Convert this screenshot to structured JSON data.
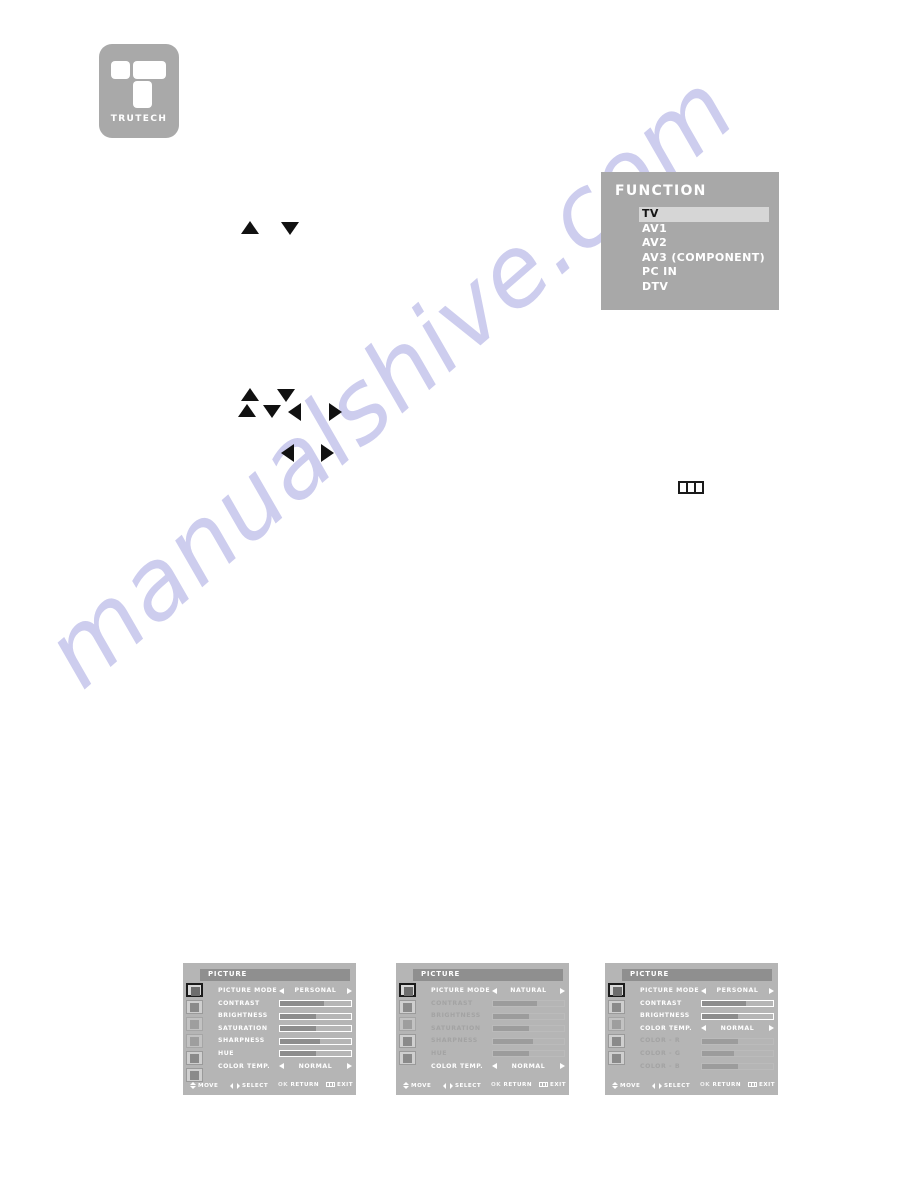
{
  "brand": {
    "logo_text": "TRUTECH",
    "logo_icon": "trutech-t-logo",
    "logo_color": "#a9a9a9"
  },
  "watermark": {
    "text": "manualshive.com",
    "color": "#cdcdee"
  },
  "glyphs": {
    "up_arrow": "up-triangle-icon",
    "down_arrow": "down-triangle-icon",
    "left_arrow": "left-triangle-icon",
    "right_arrow": "right-triangle-icon",
    "menu_button": "menu-grid-icon"
  },
  "function_osd": {
    "title": "FUNCTION",
    "background": "#a8a8a8",
    "highlight": "#d6d6d6",
    "selected": "TV",
    "items": [
      {
        "label": "TV",
        "selected": true
      },
      {
        "label": "AV1",
        "selected": false
      },
      {
        "label": "AV2",
        "selected": false
      },
      {
        "label": "AV3 (COMPONENT)",
        "selected": false
      },
      {
        "label": "PC IN",
        "selected": false
      },
      {
        "label": "DTV",
        "selected": false
      }
    ]
  },
  "footer_hints": {
    "move": "MOVE",
    "select": "SELECT",
    "ok": "OK",
    "return": "RETURN",
    "exit": "EXIT"
  },
  "picture_osds": [
    {
      "title": "PICTURE",
      "sidebar_icons": [
        {
          "name": "picture-tab-icon",
          "active": true,
          "faint": false
        },
        {
          "name": "sound-tab-icon",
          "active": false,
          "faint": false
        },
        {
          "name": "tune-tab-icon",
          "active": false,
          "faint": true
        },
        {
          "name": "setup-tab-icon",
          "active": false,
          "faint": true
        },
        {
          "name": "pc-tab-icon",
          "active": false,
          "faint": false
        },
        {
          "name": "lock-tab-icon",
          "active": false,
          "faint": false
        }
      ],
      "rows": [
        {
          "label": "PICTURE MODE",
          "type": "stepper",
          "value": "PERSONAL",
          "dim": false
        },
        {
          "label": "CONTRAST",
          "type": "bar",
          "fill": 62,
          "dim": false
        },
        {
          "label": "BRIGHTNESS",
          "type": "bar",
          "fill": 50,
          "dim": false
        },
        {
          "label": "SATURATION",
          "type": "bar",
          "fill": 50,
          "dim": false
        },
        {
          "label": "SHARPNESS",
          "type": "bar",
          "fill": 56,
          "dim": false
        },
        {
          "label": "HUE",
          "type": "bar",
          "fill": 50,
          "dim": false
        },
        {
          "label": "COLOR TEMP.",
          "type": "stepper",
          "value": "NORMAL",
          "dim": false
        }
      ]
    },
    {
      "title": "PICTURE",
      "sidebar_icons": [
        {
          "name": "picture-tab-icon",
          "active": true,
          "faint": false
        },
        {
          "name": "sound-tab-icon",
          "active": false,
          "faint": false
        },
        {
          "name": "tune-tab-icon",
          "active": false,
          "faint": true
        },
        {
          "name": "pc-tab-icon",
          "active": false,
          "faint": false
        },
        {
          "name": "lock-tab-icon",
          "active": false,
          "faint": false
        }
      ],
      "rows": [
        {
          "label": "PICTURE MODE",
          "type": "stepper",
          "value": "NATURAL",
          "dim": false
        },
        {
          "label": "CONTRAST",
          "type": "bar",
          "fill": 62,
          "dim": true
        },
        {
          "label": "BRIGHTNESS",
          "type": "bar",
          "fill": 50,
          "dim": true
        },
        {
          "label": "SATURATION",
          "type": "bar",
          "fill": 50,
          "dim": true
        },
        {
          "label": "SHARPNESS",
          "type": "bar",
          "fill": 56,
          "dim": true
        },
        {
          "label": "HUE",
          "type": "bar",
          "fill": 50,
          "dim": true
        },
        {
          "label": "COLOR TEMP.",
          "type": "stepper",
          "value": "NORMAL",
          "dim": false
        }
      ]
    },
    {
      "title": "PICTURE",
      "sidebar_icons": [
        {
          "name": "picture-tab-icon",
          "active": true,
          "faint": false
        },
        {
          "name": "sound-tab-icon",
          "active": false,
          "faint": false
        },
        {
          "name": "tune-tab-icon",
          "active": false,
          "faint": true
        },
        {
          "name": "pc-tab-icon",
          "active": false,
          "faint": false
        },
        {
          "name": "lock-tab-icon",
          "active": false,
          "faint": false
        }
      ],
      "rows": [
        {
          "label": "PICTURE MODE",
          "type": "stepper",
          "value": "PERSONAL",
          "dim": false
        },
        {
          "label": "CONTRAST",
          "type": "bar",
          "fill": 62,
          "dim": false
        },
        {
          "label": "BRIGHTNESS",
          "type": "bar",
          "fill": 50,
          "dim": false
        },
        {
          "label": "COLOR TEMP.",
          "type": "stepper",
          "value": "NORMAL",
          "dim": false
        },
        {
          "label": "COLOR - R",
          "type": "bar",
          "fill": 50,
          "dim": true
        },
        {
          "label": "COLOR - G",
          "type": "bar",
          "fill": 45,
          "dim": true
        },
        {
          "label": "COLOR - B",
          "type": "bar",
          "fill": 50,
          "dim": true
        }
      ]
    }
  ]
}
